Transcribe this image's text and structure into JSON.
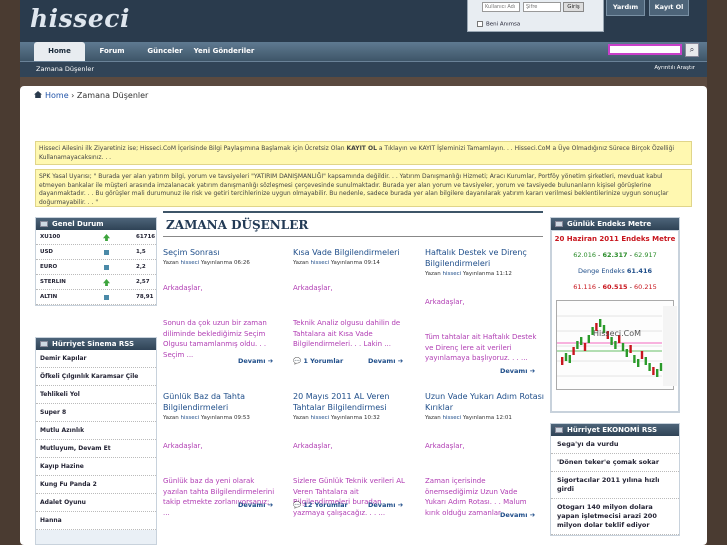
{
  "site": {
    "logo_text": "hisseci"
  },
  "login": {
    "username_placeholder": "Kullanıcı Adı",
    "password_placeholder": "Şifre",
    "button": "Giriş",
    "remember": "Beni Anımsa"
  },
  "topbuttons": {
    "help": "Yardım",
    "register": "Kayıt Ol"
  },
  "nav": {
    "tabs": [
      "Home",
      "Forum",
      "Günceler",
      "Yeni Gönderiler"
    ],
    "active": "Home"
  },
  "subnav": {
    "left": "Zamana Düşenler",
    "right": "Ayrıntılı Araştır"
  },
  "breadcrumb": {
    "home": "Home",
    "current": "Zamana Düşenler"
  },
  "notices": {
    "welcome_prefix": "Hisseci Ailesini ilk Ziyaretiniz ise; Hisseci.CoM İçerisinde Bilgi Paylaşımına Başlamak için Ücretsiz Olan ",
    "welcome_link": "KAYIT OL",
    "welcome_suffix": " a Tıklayın ve KAYIT İşleminizi Tamamlayın. . . Hisseci.CoM a Üye Olmadığınız Sürece Birçok Özelliği Kullanamayacaksınız. . .",
    "spk": "SPK Yasal Uyarısı; \" Burada yer alan yatırım bilgi, yorum ve tavsiyeleri \"YATIRIM DANIŞMANLIĞI\" kapsamında değildir. . . Yatırım Danışmanlığı Hizmeti; Aracı Kurumlar, Portföy yönetim şirketleri, mevduat kabul etmeyen bankalar ile müşteri arasında imzalanacak yatırım danışmanlığı sözleşmesi çerçevesinde sunulmaktadır. Burada yer alan yorum ve tavsiyeler, yorum ve tavsiyede bulunanların kişisel görüşlerine dayanmaktadır. . . Bu görüşler mali durumunuz ile risk ve getiri tercihlerinize uygun olmayabilir. Bu nedenle, sadece burada yer alan bilgilere dayanılarak yatırım kararı verilmesi beklentilerinize uygun sonuçlar doğurmayabilir. . . \""
  },
  "genel_durum": {
    "title": "Genel Durum",
    "rows": [
      {
        "name": "XU100",
        "value": "61716",
        "trend": "up"
      },
      {
        "name": "USD",
        "value": "1,5",
        "trend": "flat"
      },
      {
        "name": "EURO",
        "value": "2,2",
        "trend": "flat"
      },
      {
        "name": "STERLIN",
        "value": "2,57",
        "trend": "up"
      },
      {
        "name": "ALTIN",
        "value": "78,91",
        "trend": "flat"
      }
    ]
  },
  "sinema": {
    "title": "Hürriyet Sinema   RSS",
    "items": [
      "Demir Kapılar",
      "Öfkeli Çılgınlık Karamsar Çile",
      "Tehlikeli Yol",
      "Super 8",
      "Mutlu Azınlık",
      "Mutluyum, Devam Et",
      "Kayıp Hazine",
      "Kung Fu Panda 2",
      "Adalet Oyunu",
      "Hanna"
    ]
  },
  "center": {
    "title": "ZAMANA DÜŞENLER",
    "posts": [
      {
        "title": "Seçim Sonrası",
        "author": "hisseci",
        "date": "06:26",
        "greet": "Arkadaşlar,",
        "body": "Sonun da çok uzun bir zaman diliminde beklediğimiz Seçim Olgusu tamamlanmış oldu. . . Seçim ...",
        "comments": "",
        "more": "Devamı"
      },
      {
        "title": "Kısa Vade Bilgilendirmeleri",
        "author": "hisseci",
        "date": "09:14",
        "greet": "Arkadaşlar,",
        "body": "Teknik Analiz olgusu dahilin de Tahtalara ait Kısa Vade Bilgilendirmeleri. . . Lakin ...",
        "comments": "1 Yorumlar",
        "more": "Devamı"
      },
      {
        "title": "Haftalık Destek ve Direnç Bilgilendirmeleri",
        "author": "hisseci",
        "date": "11:12",
        "greet": "Arkadaşlar,",
        "body": "Tüm tahtalar ait Haftalık Destek ve Direnç lere ait verileri yayınlamaya başlıyoruz. . . ...",
        "comments": "",
        "more": "Devamı"
      },
      {
        "title": "Günlük Baz da Tahta Bilgilendirmeleri",
        "author": "hisseci",
        "date": "09:53",
        "greet": "Arkadaşlar,",
        "body": "Günlük baz da yeni olarak yazılan tahta Bilgilendirmelerini takip etmekte zorlanıyorsanız; ...",
        "comments": "",
        "more": "Devamı"
      },
      {
        "title": "20 Mayıs 2011 AL Veren Tahtalar Bilgilendirmesi",
        "author": "hisseci",
        "date": "10:32",
        "greet": "Arkadaşlar,",
        "body": "Sizlere Günlük Teknik verileri AL Veren Tahtalara ait Bilgilendirmeleri buradan yazmaya çalışacağız. . . ...",
        "comments": "12 Yorumlar",
        "more": "Devamı"
      },
      {
        "title": "Uzun Vade Yukarı Adım Rotası Kırıklar",
        "author": "hisseci",
        "date": "12:01",
        "greet": "Arkadaşlar,",
        "body": "Zaman içerisinde önemsediğimiz Uzun Vade Yukarı Adım Rotası. . . Malum kırık olduğu zamanlar ...",
        "comments": "",
        "more": "Devamı"
      }
    ],
    "meta_prefix": "Yazan",
    "meta_mid": "Yayınlanma"
  },
  "endeks": {
    "title": "Günlük Endeks Metre",
    "date_line": "20 Haziran 2011 Endeks Metre",
    "row1": {
      "a": "62.016",
      "b": "62.317",
      "c": "62.917"
    },
    "denge_label": "Denge Endeks",
    "denge_value": "61.416",
    "row3": {
      "a": "61.116",
      "b": "60.515",
      "c": "60.215"
    },
    "chart_brand": "Hisseci.CoM"
  },
  "ekonomi": {
    "title": "Hürriyet EKONOMİ   RSS",
    "items": [
      "Sega'yı da vurdu",
      "'Dönen teker'e çomak sokar",
      "Sigortacılar 2011 yılına hızlı girdi",
      "Otogarı 140 milyon dolara yapan işletmecisi arazi 200 milyon dolar teklif ediyor"
    ]
  },
  "colors": {
    "accent": "#c83fc9",
    "nav": "#3e5568",
    "link": "#1f4e8a"
  }
}
